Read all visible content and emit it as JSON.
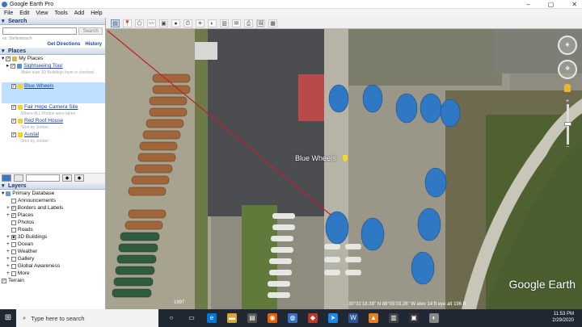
{
  "window": {
    "title": "Google Earth Pro"
  },
  "menu": [
    "File",
    "Edit",
    "View",
    "Tools",
    "Add",
    "Help"
  ],
  "search": {
    "header": "Search",
    "placeholder": "",
    "button": "Search",
    "example": "ex: Stellenbosch",
    "links": {
      "directions": "Get Directions",
      "history": "History"
    }
  },
  "places": {
    "header": "Places",
    "items": [
      {
        "label": "My Places",
        "link": false,
        "sub": ""
      },
      {
        "label": "Sightseeing Tour",
        "link": true,
        "sub": "Make sure 3D Buildings layer is checked"
      },
      {
        "label": "Blue Wheels",
        "link": true,
        "sub": "",
        "selected": true
      },
      {
        "label": "Fair Hope Camera Site",
        "link": true,
        "sub": "Where ALL Photos were taken"
      },
      {
        "label": "Red Roof House",
        "link": true,
        "sub": "Shot by Jordan"
      },
      {
        "label": "Austal",
        "link": true,
        "sub": "Shot by Jordan"
      }
    ]
  },
  "layers": {
    "header": "Layers",
    "items": [
      "Primary Database",
      "Announcements",
      "Borders and Labels",
      "Places",
      "Photos",
      "Roads",
      "3D Buildings",
      "Ocean",
      "Weather",
      "Gallery",
      "Global Awareness",
      "More",
      "Terrain"
    ]
  },
  "map": {
    "placemark_label": "Blue Wheels",
    "status": "30°31'18.39\" N   88°05'03.26\" W   elev   14 ft   eye alt  196 ft",
    "watermark": "Google Earth",
    "imagery_date": "1997"
  },
  "taskbar": {
    "search_placeholder": "Type here to search",
    "time": "11:53 PM",
    "date": "2/29/2020"
  }
}
